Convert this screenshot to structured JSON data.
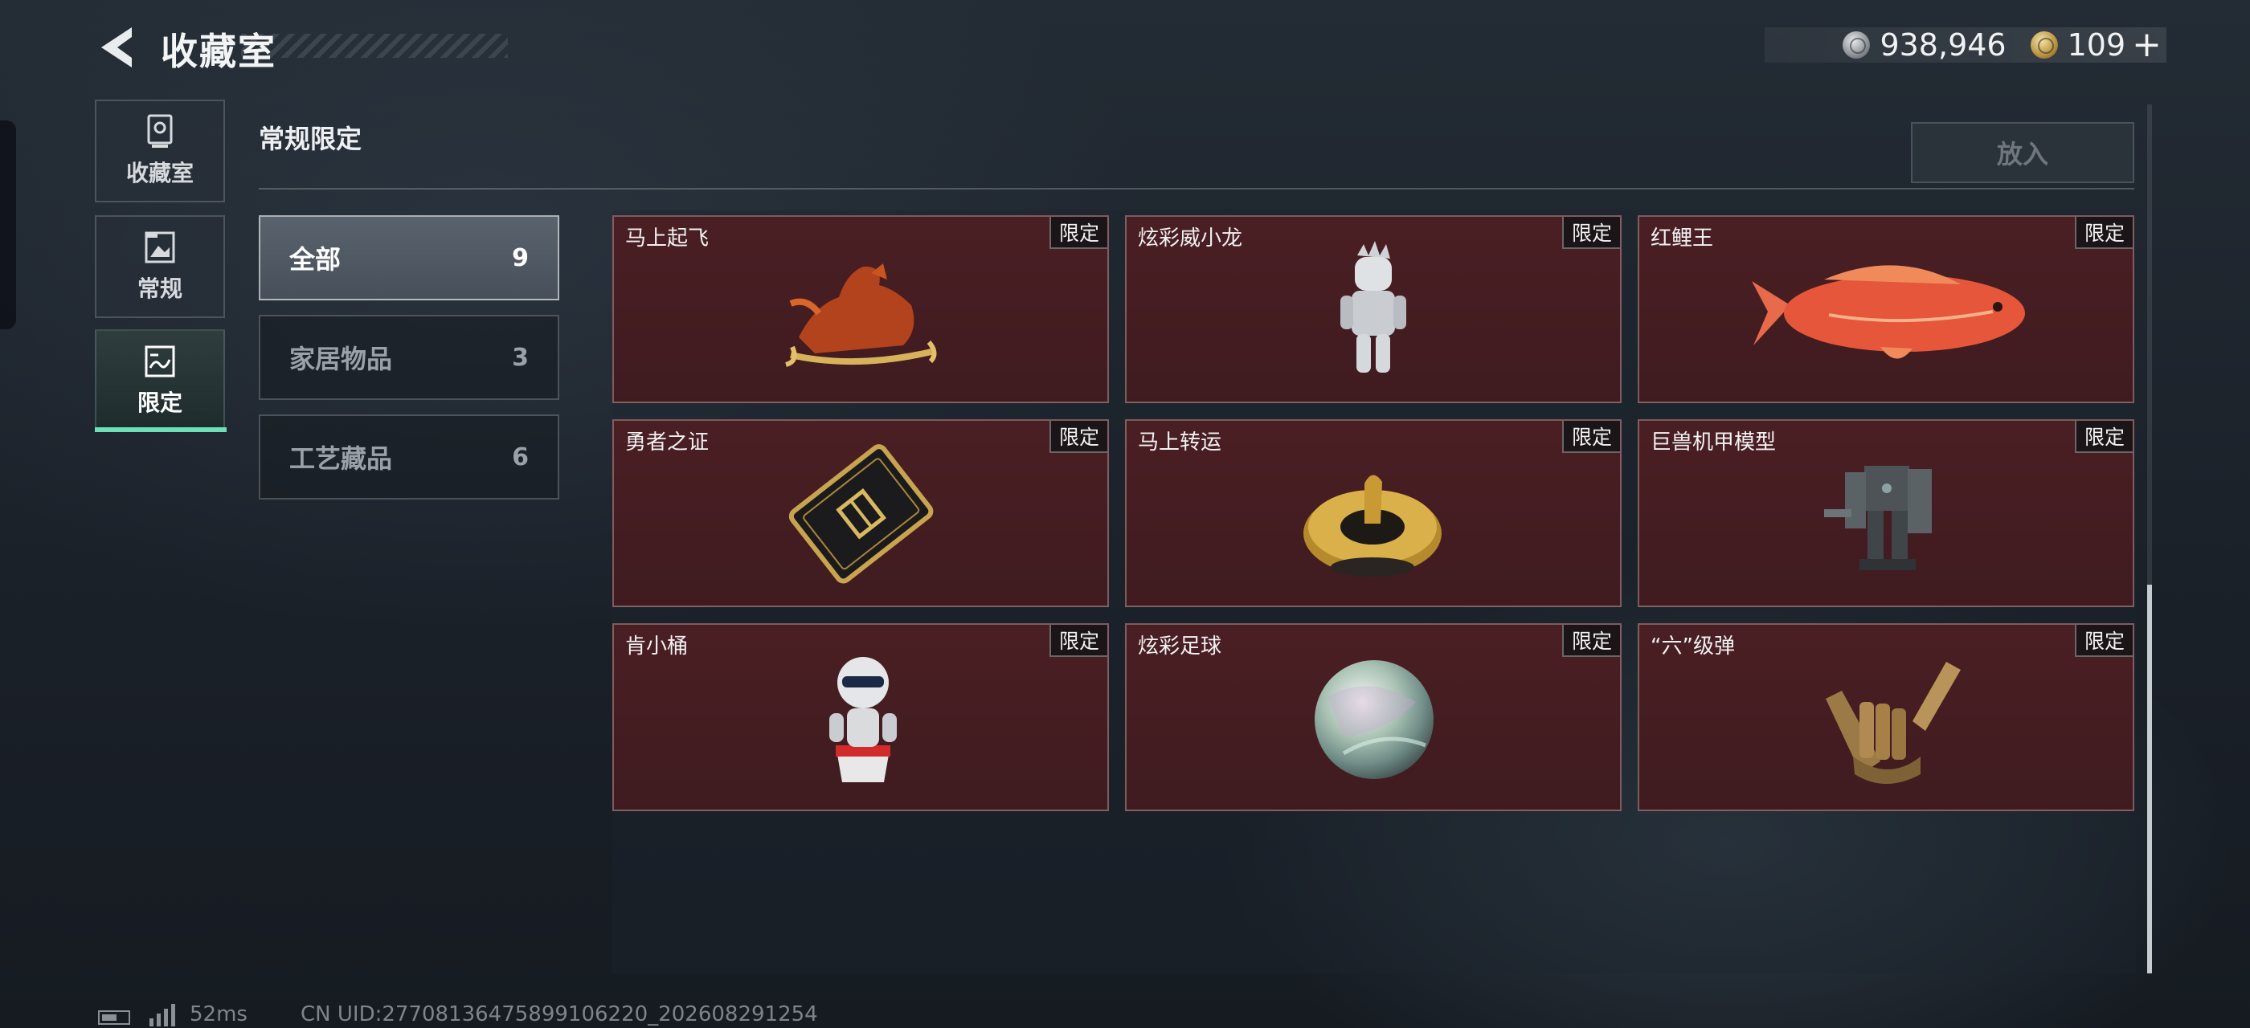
{
  "header": {
    "title": "收藏室",
    "currency_silver": "938,946",
    "currency_gold": "109",
    "plus": "+"
  },
  "nav": {
    "tabs": [
      {
        "label": "收藏室",
        "icon": "trophy-icon"
      },
      {
        "label": "常规",
        "icon": "picture-icon"
      },
      {
        "label": "限定",
        "icon": "limited-picture-icon"
      }
    ],
    "active": "限定"
  },
  "section": {
    "title": "常规限定",
    "put_button": "放入"
  },
  "categories": [
    {
      "name": "全部",
      "count": "9"
    },
    {
      "name": "家居物品",
      "count": "3"
    },
    {
      "name": "工艺藏品",
      "count": "6"
    }
  ],
  "items": [
    {
      "name": "马上起飞",
      "badge": "限定",
      "art": "horse-sled-icon"
    },
    {
      "name": "炫彩威小龙",
      "badge": "限定",
      "art": "silver-figure-icon"
    },
    {
      "name": "红鲤王",
      "badge": "限定",
      "art": "red-carp-icon"
    },
    {
      "name": "勇者之证",
      "badge": "限定",
      "art": "black-card-icon"
    },
    {
      "name": "马上转运",
      "badge": "限定",
      "art": "golden-dial-icon"
    },
    {
      "name": "巨兽机甲模型",
      "badge": "限定",
      "art": "mech-model-icon"
    },
    {
      "name": "肯小桶",
      "badge": "限定",
      "art": "bucket-figure-icon"
    },
    {
      "name": "炫彩足球",
      "badge": "限定",
      "art": "iridescent-ball-icon"
    },
    {
      "name": "“六”级弹",
      "badge": "限定",
      "art": "bullet-hand-icon"
    }
  ],
  "footer": {
    "ping": "52ms",
    "uid": "CN UID:27708136475899106220_202608291254"
  },
  "colors": {
    "accent": "#6de0b6",
    "card_bg": "#4a1f24",
    "page_bg": "#1b2129"
  }
}
